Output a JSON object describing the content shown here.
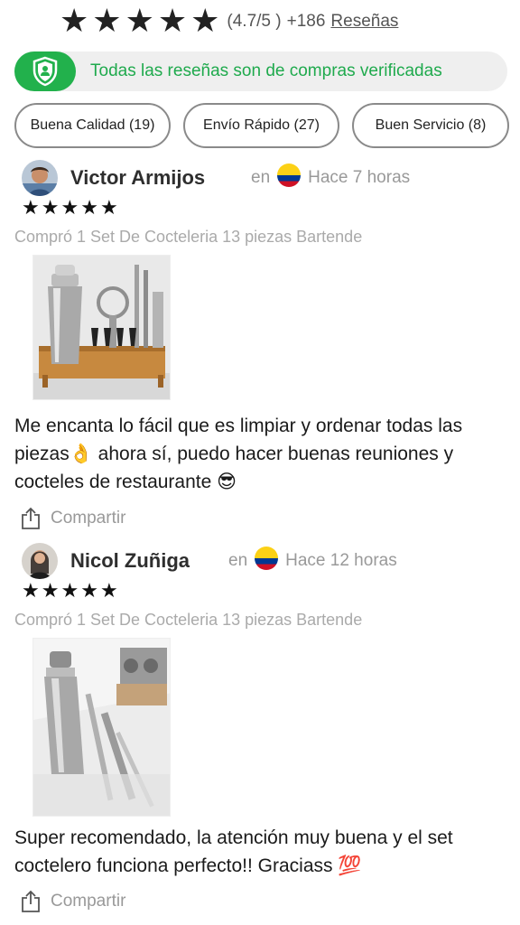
{
  "rating": {
    "stars": [
      "★",
      "★",
      "★",
      "★",
      "★"
    ],
    "score_text": "(4.7/5 )",
    "count_text": "+186",
    "reviews_link": "Reseñas"
  },
  "verified_banner": {
    "icon": "shield-user-icon",
    "text": "Todas las reseñas son de compras verificadas",
    "color": "#22b14c"
  },
  "chips": [
    {
      "label": "Buena Calidad (19)"
    },
    {
      "label": "Envío Rápido (27)"
    },
    {
      "label": "Buen Servicio (8)"
    }
  ],
  "reviews": [
    {
      "name": "Victor Armijos",
      "prefix": "en",
      "country_flag": "colombia-flag",
      "time": "Hace 7 horas",
      "stars": [
        "★",
        "★",
        "★",
        "★",
        "★"
      ],
      "product": "Compró 1 Set De Cocteleria 13 piezas Bartende",
      "photo": "cocktail-set-photo",
      "text": "Me encanta lo fácil que es limpiar y ordenar todas las piezas👌 ahora sí, puedo hacer buenas reuniones y cocteles de restaurante 😎",
      "share_label": "Compartir"
    },
    {
      "name": "Nicol Zuñiga",
      "prefix": "en",
      "country_flag": "colombia-flag",
      "time": "Hace 12 horas",
      "stars": [
        "★",
        "★",
        "★",
        "★",
        "★"
      ],
      "product": "Compró 1 Set De Cocteleria 13 piezas Bartende",
      "photo": "cocktail-shaker-photo",
      "text": "Super recomendado, la atención muy buena y el set coctelero funciona perfecto!! Graciass 💯",
      "share_label": "Compartir"
    }
  ]
}
